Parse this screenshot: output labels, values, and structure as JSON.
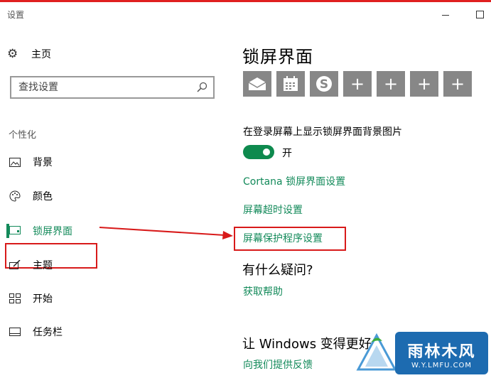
{
  "window": {
    "title": "设置"
  },
  "sidebar": {
    "home_label": "主页",
    "search_placeholder": "查找设置",
    "group_label": "个性化",
    "items": [
      {
        "label": "背景",
        "icon": "picture-icon"
      },
      {
        "label": "颜色",
        "icon": "palette-icon"
      },
      {
        "label": "锁屏界面",
        "icon": "lock-screen-icon",
        "active": true
      },
      {
        "label": "主题",
        "icon": "theme-brush-icon"
      },
      {
        "label": "开始",
        "icon": "start-grid-icon"
      },
      {
        "label": "任务栏",
        "icon": "taskbar-icon"
      }
    ]
  },
  "main": {
    "title": "锁屏界面",
    "tiles": [
      "mail-icon",
      "calendar-icon",
      "skype-icon",
      "plus-icon",
      "plus-icon",
      "plus-icon",
      "plus-icon"
    ],
    "tile_plus": "+",
    "show_background_label": "在登录屏幕上显示锁屏界面背景图片",
    "toggle_state": "开",
    "links": {
      "cortana": "Cortana 锁屏界面设置",
      "timeout": "屏幕超时设置",
      "screensaver": "屏幕保护程序设置",
      "get_help": "获取帮助",
      "feedback": "向我们提供反馈"
    },
    "question_heading": "有什么疑问?",
    "improve_heading": "让 Windows 变得更好"
  },
  "colors": {
    "accent": "#138a5a",
    "annotation_red": "#d81a1a",
    "tile_gray": "#878787"
  },
  "watermark": {
    "title": "雨林木风",
    "url": "W.Y.LMFU.COM"
  }
}
